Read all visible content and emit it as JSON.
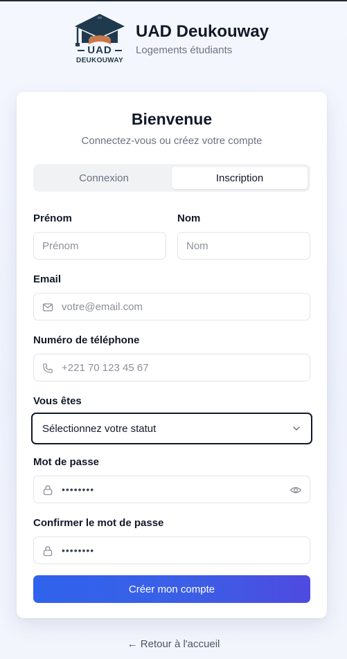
{
  "brand": {
    "logo_top": "UAD",
    "logo_bottom": "DEUKOUWAY",
    "name": "UAD Deukouway",
    "tagline": "Logements étudiants"
  },
  "card": {
    "title": "Bienvenue",
    "subtitle": "Connectez-vous ou créez votre compte"
  },
  "tabs": [
    {
      "label": "Connexion",
      "active": false
    },
    {
      "label": "Inscription",
      "active": true
    }
  ],
  "form": {
    "first_name": {
      "label": "Prénom",
      "placeholder": "Prénom"
    },
    "last_name": {
      "label": "Nom",
      "placeholder": "Nom"
    },
    "email": {
      "label": "Email",
      "placeholder": "votre@email.com",
      "icon": "mail-icon"
    },
    "phone": {
      "label": "Numéro de téléphone",
      "placeholder": "+221 70 123 45 67",
      "icon": "phone-icon"
    },
    "status": {
      "label": "Vous êtes",
      "selected": "Sélectionnez votre statut",
      "icon": "chevron-down-icon"
    },
    "password": {
      "label": "Mot de passe",
      "value": "••••••••",
      "icon": "lock-icon",
      "toggle_icon": "eye-icon"
    },
    "confirm_password": {
      "label": "Confirmer le mot de passe",
      "value": "••••••••",
      "icon": "lock-icon"
    },
    "submit_label": "Créer mon compte"
  },
  "footer": {
    "back_link": "← Retour à l'accueil"
  },
  "colors": {
    "primary_start": "#2f63ec",
    "primary_end": "#4e4ae0",
    "logo_navy": "#1f3a4d",
    "logo_orange": "#c8784a"
  }
}
